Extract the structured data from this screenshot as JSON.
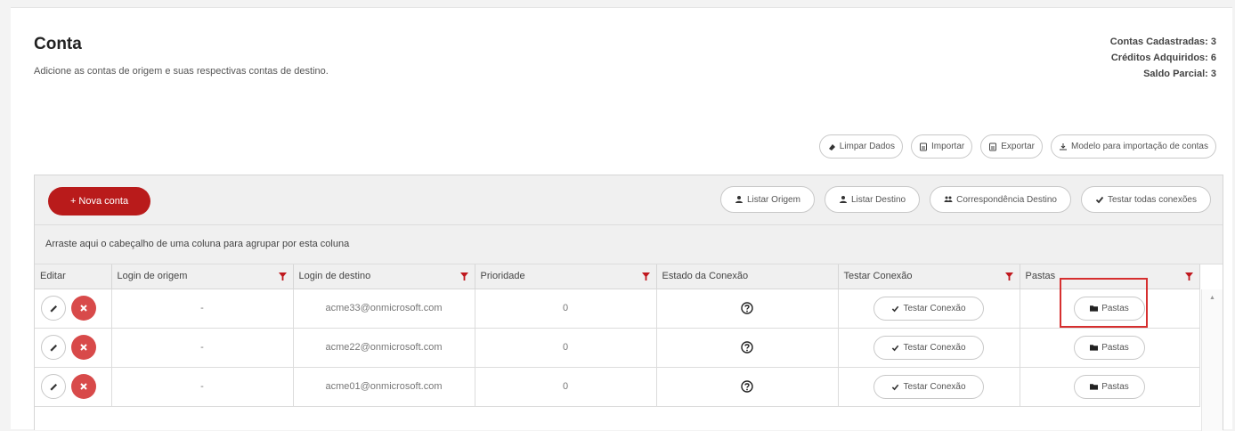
{
  "header": {
    "title": "Conta",
    "subtitle": "Adicione as contas de origem e suas respectivas contas de destino."
  },
  "stats": {
    "registered": "Contas Cadastradas: 3",
    "credits": "Créditos Adquiridos: 6",
    "balance": "Saldo Parcial: 3"
  },
  "top_actions": {
    "clear": "Limpar Dados",
    "import": "Importar",
    "export": "Exportar",
    "template": "Modelo para importação de contas"
  },
  "toolbar": {
    "new_account": "+ Nova conta",
    "list_source": "Listar Origem",
    "list_destination": "Listar Destino",
    "destination_match": "Correspondência Destino",
    "test_all": "Testar todas conexões"
  },
  "group_hint": "Arraste aqui o cabeçalho de uma coluna para agrupar por esta coluna",
  "columns": [
    "Editar",
    "Login de origem",
    "Login de destino",
    "Prioridade",
    "Estado da Conexão",
    "Testar Conexão",
    "Pastas"
  ],
  "rows": [
    {
      "source": "-",
      "destination": "acme33@onmicrosoft.com",
      "priority": "0",
      "test_label": "Testar Conexão",
      "folders_label": "Pastas"
    },
    {
      "source": "-",
      "destination": "acme22@onmicrosoft.com",
      "priority": "0",
      "test_label": "Testar Conexão",
      "folders_label": "Pastas"
    },
    {
      "source": "-",
      "destination": "acme01@onmicrosoft.com",
      "priority": "0",
      "test_label": "Testar Conexão",
      "folders_label": "Pastas"
    }
  ],
  "colors": {
    "accent": "#b91b1b",
    "delete": "#d84a4a",
    "filter": "#c0181e",
    "highlight": "#d62f2f"
  }
}
